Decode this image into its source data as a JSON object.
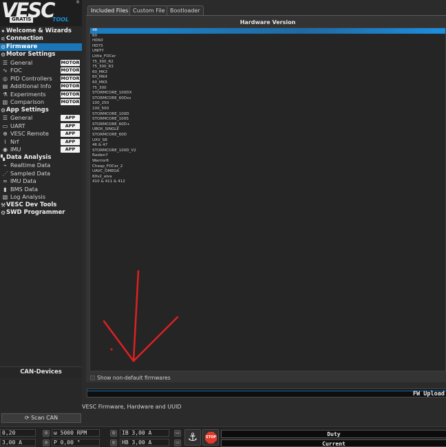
{
  "logo": {
    "brand": "VESC",
    "sub_left": "GRATIS",
    "sub_right": "TOOL",
    "reg": "®"
  },
  "sidebar": {
    "welcome": "Welcome & Wizards",
    "connection": "Connection",
    "firmware": "Firmware",
    "motor_settings": "Motor Settings",
    "motor_items": [
      {
        "label": "General",
        "badge": "MOTOR"
      },
      {
        "label": "FOC",
        "badge": "MOTOR"
      },
      {
        "label": "PID Controllers",
        "badge": "MOTOR"
      },
      {
        "label": "Additional Info",
        "badge": "MOTOR"
      },
      {
        "label": "Experiments",
        "badge": "MOTOR"
      },
      {
        "label": "Comparison",
        "badge": "MOTOR"
      }
    ],
    "app_settings": "App Settings",
    "app_items": [
      {
        "label": "General",
        "badge": "APP"
      },
      {
        "label": "UART",
        "badge": "APP"
      },
      {
        "label": "VESC Remote",
        "badge": "APP"
      },
      {
        "label": "Nrf",
        "badge": "APP"
      },
      {
        "label": "IMU",
        "badge": "APP"
      }
    ],
    "data_analysis": "Data Analysis",
    "data_items": [
      "Realtime Data",
      "Sampled Data",
      "IMU Data",
      "BMS Data",
      "Log Analysis"
    ],
    "dev_tools": "VESC Dev Tools",
    "swd": "SWD Programmer",
    "can_devices": "CAN-Devices",
    "scan_can": "Scan CAN"
  },
  "tabs": [
    "Included Files",
    "Custom File",
    "Bootloader"
  ],
  "hardware": {
    "header": "Hardware Version",
    "versions": [
      "48",
      "60",
      "HD60",
      "HD75",
      "UNITY",
      "Little_FOCer",
      "75_300_R2",
      "75_300_R3",
      "60_MK3",
      "60_MK4",
      "60_MK5",
      "75_300",
      "STORMCORE_100DX",
      "STORMCORE_60Dxs",
      "100_250",
      "100_500",
      "STORMCORE_100D",
      "STORMCORE_100S",
      "STORMCORE_60D+",
      "UBOX_SINGLE",
      "STORMCORE_60D",
      "UXV_SR",
      "46 & 47",
      "STORMCORE_100D_V2",
      "Raiden7",
      "Warrior6",
      "Cheap_FOCer_2",
      "UAVC_OMEGA",
      "60v2_alva",
      "410 & 411 & 412"
    ],
    "selected": "48",
    "show_non_default": "Show non-default firmwares"
  },
  "upload": {
    "label": "FW Upload"
  },
  "status": "VESC Firmware, Hardware and UUID",
  "bottom": {
    "row1": {
      "duty_in": "0,20",
      "rpm": "ω 5000 RPM",
      "ib": "IB 3,00 A"
    },
    "row2": {
      "cur_in": "3,00 A",
      "pos": "P 0,00 °",
      "hb": "HB 3,00 A"
    },
    "stop": "STOP",
    "gauge_duty": "Duty",
    "gauge_current": "Current"
  }
}
